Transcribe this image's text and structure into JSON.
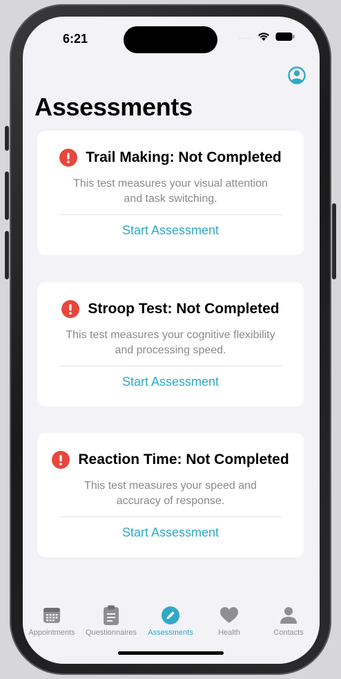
{
  "status_bar": {
    "time": "6:21",
    "signal": "....."
  },
  "header": {
    "title": "Assessments"
  },
  "assessments": [
    {
      "title": "Trail Making: Not Completed",
      "description": "This test measures your visual attention and task switching.",
      "action": "Start Assessment"
    },
    {
      "title": "Stroop Test: Not Completed",
      "description": "This test measures your cognitive flexibility and processing speed.",
      "action": "Start Assessment"
    },
    {
      "title": "Reaction Time: Not Completed",
      "description": "This test measures your speed and accuracy of response.",
      "action": "Start Assessment"
    }
  ],
  "tabbar": {
    "items": [
      {
        "label": "Appointments",
        "icon": "calendar-icon"
      },
      {
        "label": "Questionnaires",
        "icon": "clipboard-icon"
      },
      {
        "label": "Assessments",
        "icon": "pencil-circle-icon",
        "active": true
      },
      {
        "label": "Health",
        "icon": "heart-icon"
      },
      {
        "label": "Contacts",
        "icon": "person-icon"
      }
    ]
  },
  "colors": {
    "accent": "#30a9c6",
    "alert": "#e8473b",
    "background": "#f2f2f7",
    "secondary_text": "#8a8a8e",
    "inactive_tab": "#8e8e93"
  }
}
